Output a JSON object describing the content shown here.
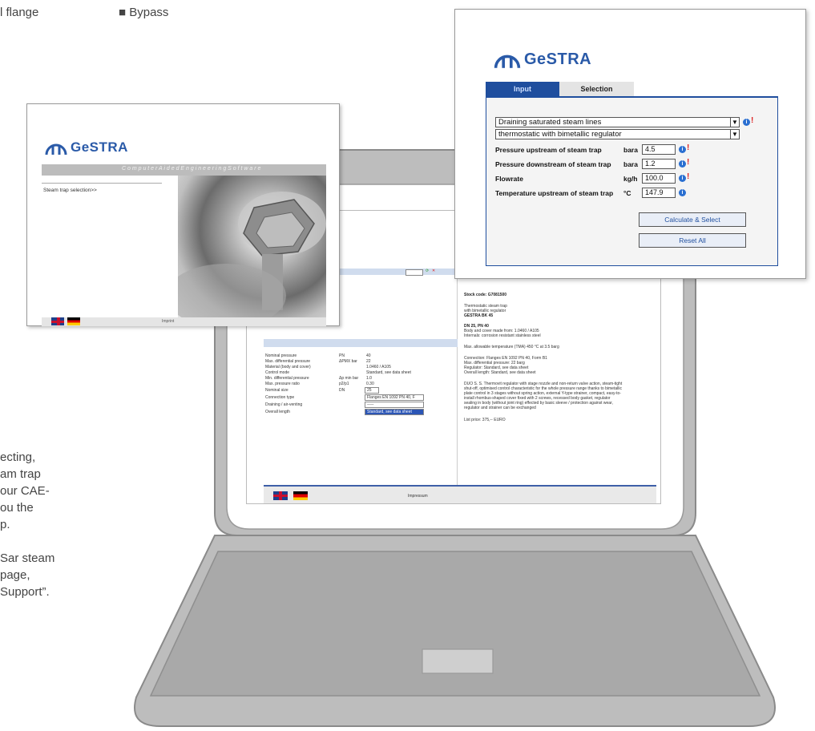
{
  "brochure": {
    "top_left": "l flange",
    "top_right": "■ Bypass",
    "body_lines": [
      "ecting,",
      "am trap",
      "our CAE-",
      "ou the",
      "p."
    ],
    "body_lines2": [
      "Sar steam",
      "page,",
      " Support”."
    ]
  },
  "welcome_window": {
    "logo_text": "GeSTRA",
    "banner": "C o m p u t e r   A i d e d   E n g i n e e r i n g   S o f t w a r e",
    "link": "Steam trap selection>>",
    "footer": "Imprint"
  },
  "screen_app": {
    "top_select": "",
    "specs": [
      {
        "label": "Nominal pressure",
        "unit": "PN",
        "value": "40"
      },
      {
        "label": "Max. differential pressure",
        "unit": "ΔPMX bar",
        "value": "22"
      },
      {
        "label": "Material (body and cover)",
        "unit": "",
        "value": "1.0460 / A105"
      },
      {
        "label": "Control mode",
        "unit": "",
        "value": "Standard, see data sheet"
      },
      {
        "label": "Min. differential pressure",
        "unit": "Δp min bar",
        "value": "1.0"
      },
      {
        "label": "Max. pressure ratio",
        "unit": "p2/p1",
        "value": "0.30"
      }
    ],
    "nominal_size": {
      "label": "Nominal size",
      "unit": "DN",
      "value": "25"
    },
    "connection": {
      "label": "Connection type",
      "value": "Flanges EN 1092 PN 40, F"
    },
    "draining": {
      "label": "Draining / air-venting",
      "value": "-----"
    },
    "overall": {
      "label": "Overall length",
      "value": "Standard, see data sheet"
    },
    "right_lines": [
      "Stock code: G7081500",
      "Thermostatic steam trap",
      "with bimetallic regulator",
      "GESTRA BK 45",
      "DN 25, PN 40",
      "Body and cover made from: 1.0460 / A105",
      "Internals: corrosion resistant stainless steel",
      "Max. allowable temperature (TMA) 450 °C at 3.5 barg",
      "Connection: Flanges EN 1092 PN 40, Form B1",
      "Max. differential pressure: 22 barg",
      "Regulator: Standard, see data sheet",
      "Overall length: Standard, see data sheet",
      "DUO S. S. Thermovit regulator with stage nozzle and non-return valve action, steam-tight",
      "shut-off, optimised control characteristic for the whole pressure range thanks to bimetallic",
      "plate control in 3 stages without spring action, external Y-type strainer, compact, easy-to-",
      "install rhombus-shaped cover fixed with 2 screws, recessed body gasket, regulator",
      "sealing in body (without joint ring) effected by basic sleeve / protection against wear,",
      "regulator and strainer can be exchanged",
      "List price: 375,-- EURO"
    ],
    "footer": "Impressum"
  },
  "input_window": {
    "logo_text": "GeSTRA",
    "tabs": [
      {
        "label": "Input"
      },
      {
        "label": "Selection"
      }
    ],
    "application": "Draining saturated steam lines",
    "trap_type": "thermostatic with bimetallic regulator",
    "rows": [
      {
        "label": "Pressure upstream of steam trap",
        "unit": "bara",
        "value": "4.5"
      },
      {
        "label": "Pressure downstream of steam trap",
        "unit": "bara",
        "value": "1.2"
      },
      {
        "label": "Flowrate",
        "unit": "kg/h",
        "value": "100.0"
      },
      {
        "label": "Temperature upstream of steam trap",
        "unit": "°C",
        "value": "147.9"
      }
    ],
    "buttons": {
      "calculate": "Calculate & Select",
      "reset": "Reset All"
    }
  }
}
